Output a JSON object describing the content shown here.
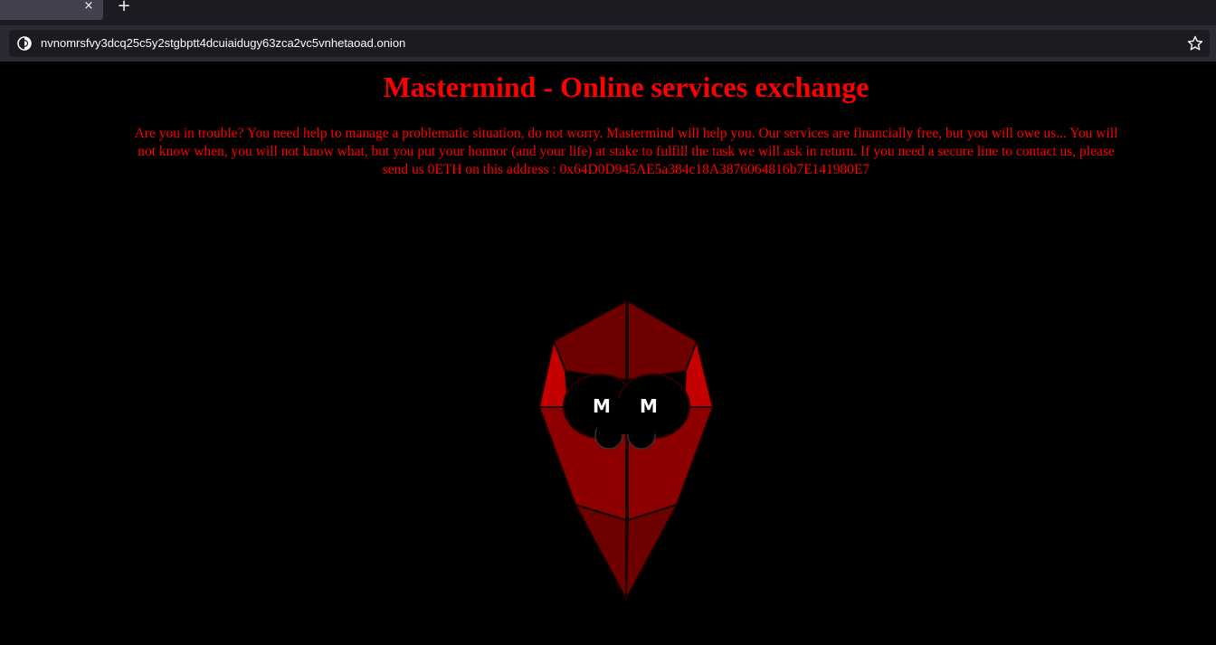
{
  "browser": {
    "tab": {
      "close_glyph": "×"
    },
    "new_tab_glyph": "+",
    "url": "nvnomrsfvy3dcq25c5y2stgbptt4dcuiaidugy63zca2vc5vnhetaoad.onion",
    "icons": {
      "site": "onion-icon",
      "bookmark": "star-icon"
    }
  },
  "page": {
    "title": "Mastermind - Online services exchange",
    "intro": "Are you in trouble? You need help to manage a problematic situation, do not worry. Mastermind will help you. Our services are financially free, but you will owe us... You will not know when, you will not know what, but you put your honnor (and your life) at stake to fulfill the task we will ask in return. If you need a secure line to contact us, please send us 0ETH on this address : 0x64D0D945AE5a384c18A3876064816b7E141980E7",
    "logo": {
      "left_letter": "M",
      "right_letter": "M"
    },
    "colors": {
      "text": "#ff0000",
      "background": "#000000",
      "logo_dark": "#6e0000",
      "logo_mid": "#8c0000",
      "logo_bright": "#c40000"
    }
  }
}
